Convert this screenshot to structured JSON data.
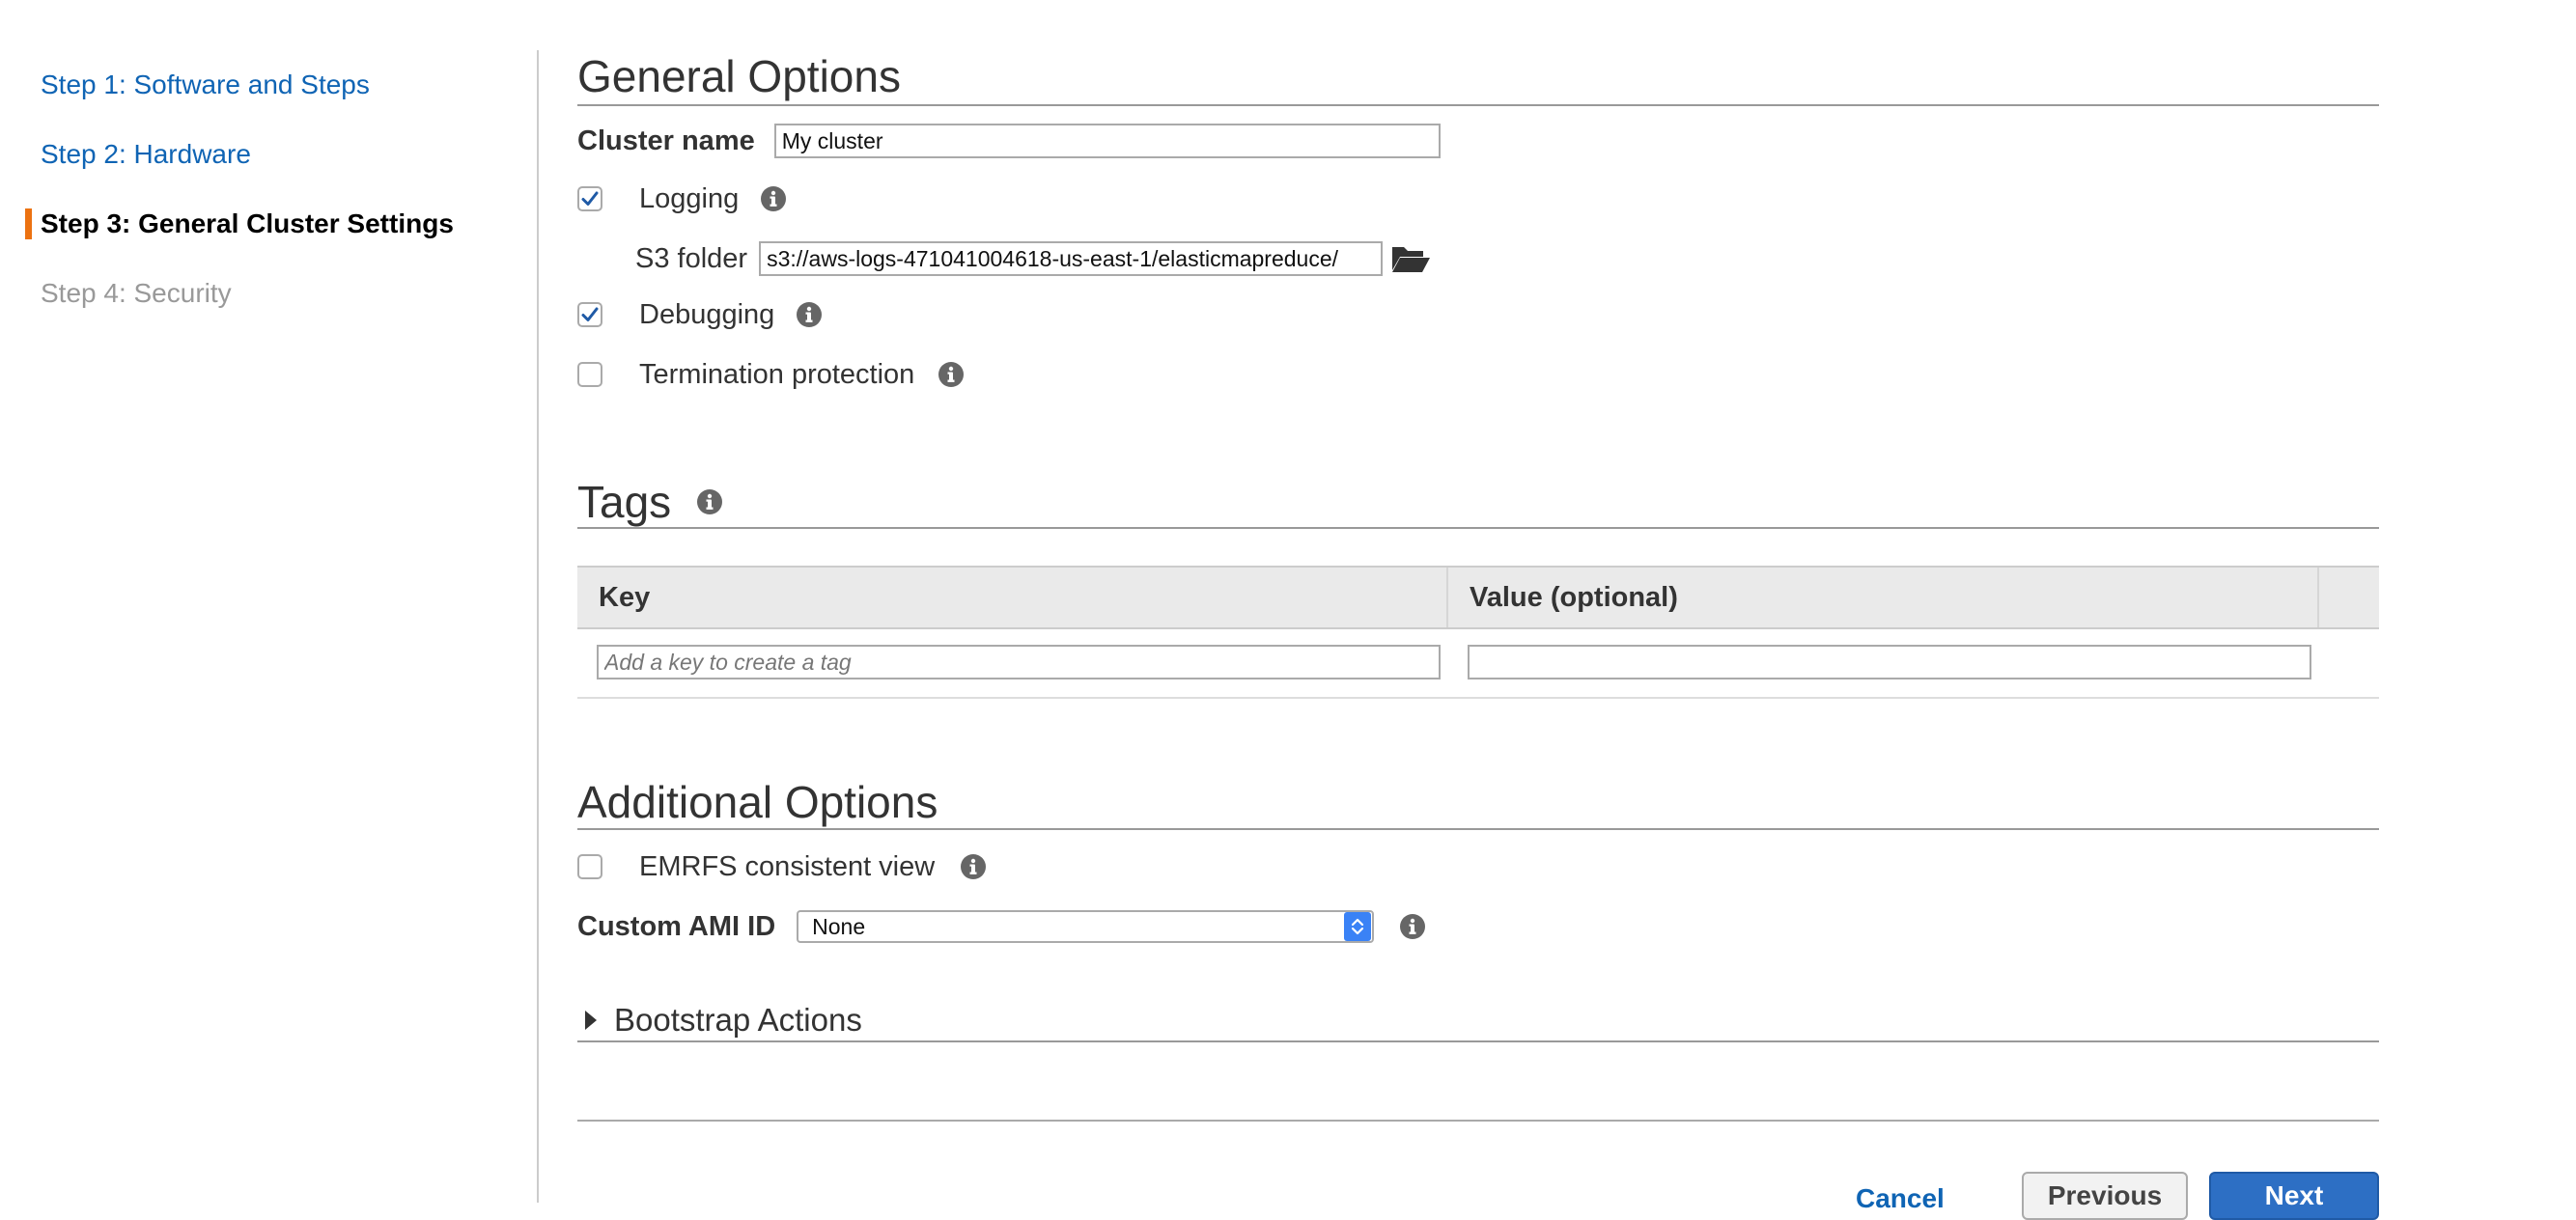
{
  "nav": {
    "steps": [
      {
        "label": "Step 1: Software and Steps",
        "state": "link"
      },
      {
        "label": "Step 2: Hardware",
        "state": "link"
      },
      {
        "label": "Step 3: General Cluster Settings",
        "state": "current"
      },
      {
        "label": "Step 4: Security",
        "state": "disabled"
      }
    ],
    "current_marker_color": "#ec7211"
  },
  "general_options": {
    "title": "General Options",
    "cluster_name_label": "Cluster name",
    "cluster_name_value": "My cluster",
    "logging": {
      "label": "Logging",
      "checked": true,
      "info_icon": "info-icon"
    },
    "s3_folder": {
      "label": "S3 folder",
      "value": "s3://aws-logs-471041004618-us-east-1/elasticmapreduce/",
      "browse_icon": "folder-open-icon"
    },
    "debugging": {
      "label": "Debugging",
      "checked": true,
      "info_icon": "info-icon"
    },
    "termination_protection": {
      "label": "Termination protection",
      "checked": false,
      "info_icon": "info-icon"
    }
  },
  "tags": {
    "title": "Tags",
    "columns": [
      "Key",
      "Value (optional)"
    ],
    "key_placeholder": "Add a key to create a tag",
    "value_placeholder": "",
    "info_icon": "info-icon"
  },
  "additional_options": {
    "title": "Additional Options",
    "emrfs": {
      "label": "EMRFS consistent view",
      "checked": false,
      "info_icon": "info-icon"
    },
    "custom_ami_label": "Custom AMI ID",
    "custom_ami_value": "None",
    "bootstrap_actions_label": "Bootstrap Actions"
  },
  "footer": {
    "cancel_label": "Cancel",
    "previous_label": "Previous",
    "next_label": "Next"
  },
  "colors": {
    "link": "#0f64b4",
    "accent_orange": "#ec7211",
    "primary_button": "#2d6fc4",
    "checkmark": "#1f5aa6"
  }
}
